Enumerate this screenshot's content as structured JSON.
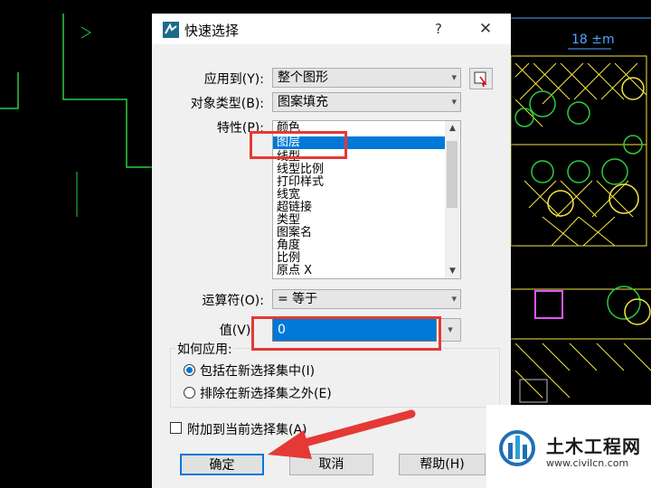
{
  "dialog": {
    "title": "快速选择",
    "help_label": "?",
    "close_label": "✕",
    "apply_to": {
      "label": "应用到(Y):",
      "value": "整个图形"
    },
    "object_type": {
      "label": "对象类型(B):",
      "value": "图案填充"
    },
    "properties": {
      "label": "特性(P):",
      "items": [
        "颜色",
        "图层",
        "线型",
        "线型比例",
        "打印样式",
        "线宽",
        "超链接",
        "类型",
        "图案名",
        "角度",
        "比例",
        "原点 X"
      ],
      "selected": "图层"
    },
    "operator": {
      "label": "运算符(O):",
      "value": "= 等于"
    },
    "value": {
      "label": "值(V):",
      "value": "0"
    },
    "how_to_apply": {
      "title": "如何应用:",
      "include_label": "包括在新选择集中(I)",
      "exclude_label": "排除在新选择集之外(E)",
      "selected": "include"
    },
    "append": {
      "label": "附加到当前选择集(A)",
      "checked": false
    },
    "buttons": {
      "ok": "确定",
      "cancel": "取消",
      "help": "帮助(H)"
    }
  },
  "cad_labels": {
    "top_label": "18 ±m"
  },
  "watermark": {
    "title": "土木工程网",
    "url": "www.civilcn.com"
  },
  "colors": {
    "accent": "#0078d7",
    "highlight": "#e53935",
    "cad_green": "#2ecc40",
    "cad_yellow": "#f5e642"
  }
}
